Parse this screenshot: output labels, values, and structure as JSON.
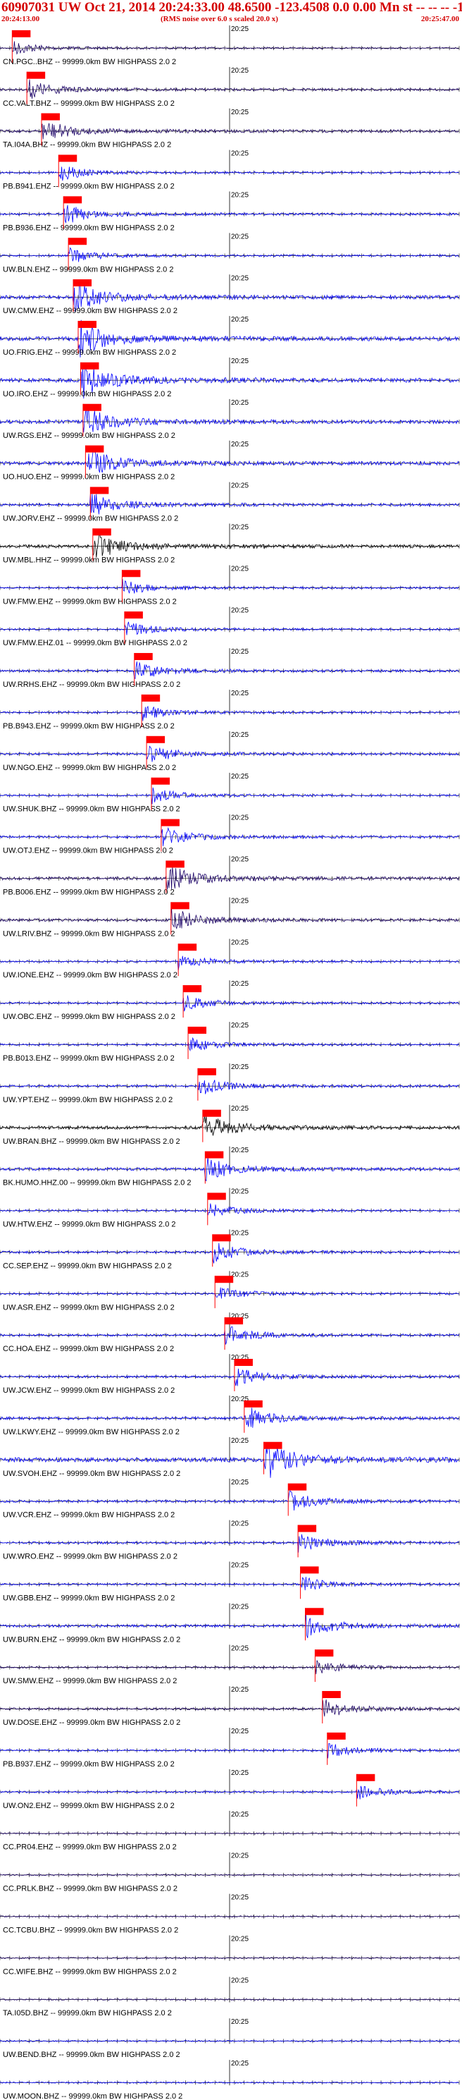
{
  "header": {
    "title": "60907031 UW Oct 21, 2014 20:24:33.00   48.6500 -123.4508  0.0 0.00 Mn st -- -- --  -1",
    "start_time": "20:24:13.00",
    "note": "(RMS noise over 6.0 s scaled 20.0 x)",
    "end_time": "20:25:47.00"
  },
  "chart_data": {
    "type": "seismogram",
    "title": "60907031 UW Oct 21, 2014 20:24:33.00   48.6500 -123.4508  0.0 0.00 Mn st -- -- --  -1",
    "x_start": "20:24:13.00",
    "x_end": "20:25:47.00",
    "x_range_seconds": [
      0,
      94
    ],
    "minute_marker": "20:25",
    "minute_marker_second": 47,
    "tick_interval_seconds": 2,
    "grid": false,
    "colors": {
      "trace": "#0000ff",
      "trace_dark": "#1a0066",
      "pick": "#ff0000",
      "text": "#000000"
    },
    "traces": [
      {
        "label": "CN.PGC..BHZ -- 99999.0km BW  HIGHPASS  2.0  2",
        "pick": 2.5,
        "color": "#1a0066",
        "amp": 0.35
      },
      {
        "label": "CC.VALT.BHZ -- 99999.0km BW  HIGHPASS  2.0  2",
        "pick": 5.5,
        "color": "#1a0066",
        "amp": 0.5
      },
      {
        "label": "TA.I04A.BHZ -- 99999.0km BW  HIGHPASS  2.0  2",
        "pick": 8.5,
        "color": "#1a0066",
        "amp": 0.6
      },
      {
        "label": "PB.B941.EHZ -- 99999.0km BW  HIGHPASS  2.0  2",
        "pick": 12.0,
        "color": "#0000ff",
        "amp": 0.4
      },
      {
        "label": "PB.B936.EHZ -- 99999.0km BW  HIGHPASS  2.0  2",
        "pick": 13.0,
        "color": "#0000ff",
        "amp": 0.5
      },
      {
        "label": "UW.BLN.EHZ -- 99999.0km BW  HIGHPASS  2.0  2",
        "pick": 14.0,
        "color": "#0000ff",
        "amp": 0.4
      },
      {
        "label": "UW.CMW.EHZ -- 99999.0km BW  HIGHPASS  2.0  2",
        "pick": 15.0,
        "color": "#0000ff",
        "amp": 0.8
      },
      {
        "label": "UO.FRIG.EHZ -- 99999.0km BW  HIGHPASS  2.0  2",
        "pick": 16.0,
        "color": "#0000ff",
        "amp": 0.9
      },
      {
        "label": "UO.IRO.EHZ -- 99999.0km BW  HIGHPASS  2.0  2",
        "pick": 16.5,
        "color": "#0000ff",
        "amp": 0.9
      },
      {
        "label": "UW.RGS.EHZ -- 99999.0km BW  HIGHPASS  2.0  2",
        "pick": 17.0,
        "color": "#0000ff",
        "amp": 0.8
      },
      {
        "label": "UO.HUO.EHZ -- 99999.0km BW  HIGHPASS  2.0  2",
        "pick": 17.5,
        "color": "#0000ff",
        "amp": 0.8
      },
      {
        "label": "UW.JORV.EHZ -- 99999.0km BW  HIGHPASS  2.0  2",
        "pick": 18.5,
        "color": "#0000ff",
        "amp": 0.6
      },
      {
        "label": "UW.MBL.HHZ -- 99999.0km BW  HIGHPASS  2.0  2",
        "pick": 19.0,
        "color": "#000000",
        "amp": 0.7
      },
      {
        "label": "UW.FMW.EHZ -- 99999.0km BW  HIGHPASS  2.0  2",
        "pick": 25.0,
        "color": "#0000ff",
        "amp": 0.4
      },
      {
        "label": "UW.FMW.EHZ.01 -- 99999.0km BW  HIGHPASS  2.0  2",
        "pick": 25.5,
        "color": "#0000ff",
        "amp": 0.4
      },
      {
        "label": "UW.RRHS.EHZ -- 99999.0km BW  HIGHPASS  2.0  2",
        "pick": 27.5,
        "color": "#0000ff",
        "amp": 0.5
      },
      {
        "label": "PB.B943.EHZ -- 99999.0km BW  HIGHPASS  2.0  2",
        "pick": 29.0,
        "color": "#0000ff",
        "amp": 0.4
      },
      {
        "label": "UW.NGO.EHZ -- 99999.0km BW  HIGHPASS  2.0  2",
        "pick": 30.0,
        "color": "#0000ff",
        "amp": 0.5
      },
      {
        "label": "UW.SHUK.BHZ -- 99999.0km BW  HIGHPASS  2.0  2",
        "pick": 31.0,
        "color": "#0000ff",
        "amp": 0.4
      },
      {
        "label": "UW.OTJ.EHZ -- 99999.0km BW  HIGHPASS  2.0  2",
        "pick": 33.0,
        "color": "#0000ff",
        "amp": 0.5
      },
      {
        "label": "PB.B006.EHZ -- 99999.0km BW  HIGHPASS  2.0  2",
        "pick": 34.0,
        "color": "#1a0066",
        "amp": 0.7
      },
      {
        "label": "UW.LRIV.BHZ -- 99999.0km BW  HIGHPASS  2.0  2",
        "pick": 35.0,
        "color": "#1a0066",
        "amp": 0.6
      },
      {
        "label": "UW.IONE.EHZ -- 99999.0km BW  HIGHPASS  2.0  2",
        "pick": 36.5,
        "color": "#0000ff",
        "amp": 0.4
      },
      {
        "label": "UW.OBC.EHZ -- 99999.0km BW  HIGHPASS  2.0  2",
        "pick": 37.5,
        "color": "#0000ff",
        "amp": 0.4
      },
      {
        "label": "PB.B013.EHZ -- 99999.0km BW  HIGHPASS  2.0  2",
        "pick": 38.5,
        "color": "#0000ff",
        "amp": 0.4
      },
      {
        "label": "UW.YPT.EHZ -- 99999.0km BW  HIGHPASS  2.0  2",
        "pick": 40.5,
        "color": "#0000ff",
        "amp": 0.5
      },
      {
        "label": "UW.BRAN.BHZ -- 99999.0km BW  HIGHPASS  2.0  2",
        "pick": 41.5,
        "color": "#000000",
        "amp": 0.7
      },
      {
        "label": "BK.HUMO.HHZ.00 -- 99999.0km BW  HIGHPASS  2.0  2",
        "pick": 42.0,
        "color": "#0000ff",
        "amp": 0.6
      },
      {
        "label": "UW.HTW.EHZ -- 99999.0km BW  HIGHPASS  2.0  2",
        "pick": 42.5,
        "color": "#0000ff",
        "amp": 0.4
      },
      {
        "label": "CC.SEP.EHZ -- 99999.0km BW  HIGHPASS  2.0  2",
        "pick": 43.5,
        "color": "#0000ff",
        "amp": 0.5
      },
      {
        "label": "UW.ASR.EHZ -- 99999.0km BW  HIGHPASS  2.0  2",
        "pick": 44.0,
        "color": "#0000ff",
        "amp": 0.4
      },
      {
        "label": "CC.HOA.EHZ -- 99999.0km BW  HIGHPASS  2.0  2",
        "pick": 46.0,
        "color": "#0000ff",
        "amp": 0.5
      },
      {
        "label": "UW.JCW.EHZ -- 99999.0km BW  HIGHPASS  2.0  2",
        "pick": 48.0,
        "color": "#0000ff",
        "amp": 0.5
      },
      {
        "label": "UW.LKWY.EHZ -- 99999.0km BW  HIGHPASS  2.0  2",
        "pick": 50.0,
        "color": "#0000ff",
        "amp": 0.6
      },
      {
        "label": "UW.SVOH.EHZ -- 99999.0km BW  HIGHPASS  2.0  2",
        "pick": 54.0,
        "color": "#0000ff",
        "amp": 1.0
      },
      {
        "label": "UW.VCR.EHZ -- 99999.0km BW  HIGHPASS  2.0  2",
        "pick": 59.0,
        "color": "#0000ff",
        "amp": 0.5
      },
      {
        "label": "UW.WRO.EHZ -- 99999.0km BW  HIGHPASS  2.0  2",
        "pick": 61.0,
        "color": "#0000ff",
        "amp": 0.5
      },
      {
        "label": "UW.GBB.EHZ -- 99999.0km BW  HIGHPASS  2.0  2",
        "pick": 61.5,
        "color": "#0000ff",
        "amp": 0.4
      },
      {
        "label": "UW.BURN.EHZ -- 99999.0km BW  HIGHPASS  2.0  2",
        "pick": 62.5,
        "color": "#0000ff",
        "amp": 0.6
      },
      {
        "label": "UW.SMW.EHZ -- 99999.0km BW  HIGHPASS  2.0  2",
        "pick": 64.5,
        "color": "#1a0066",
        "amp": 0.4
      },
      {
        "label": "UW.DOSE.EHZ -- 99999.0km BW  HIGHPASS  2.0  2",
        "pick": 66.0,
        "color": "#1a0066",
        "amp": 0.5
      },
      {
        "label": "PB.B937.EHZ -- 99999.0km BW  HIGHPASS  2.0  2",
        "pick": 67.0,
        "color": "#0000ff",
        "amp": 0.4
      },
      {
        "label": "UW.ON2.EHZ -- 99999.0km BW  HIGHPASS  2.0  2",
        "pick": 73.0,
        "color": "#0000ff",
        "amp": 0.4
      },
      {
        "label": "CC.PR04.EHZ -- 99999.0km BW  HIGHPASS  2.0  2",
        "pick": null,
        "color": "#1a0066",
        "amp": 0.3
      },
      {
        "label": "CC.PRLK.BHZ -- 99999.0km BW  HIGHPASS  2.0  2",
        "pick": null,
        "color": "#1a0066",
        "amp": 0.3
      },
      {
        "label": "CC.TCBU.BHZ -- 99999.0km BW  HIGHPASS  2.0  2",
        "pick": null,
        "color": "#1a0066",
        "amp": 0.3
      },
      {
        "label": "CC.WIFE.BHZ -- 99999.0km BW  HIGHPASS  2.0  2",
        "pick": null,
        "color": "#1a0066",
        "amp": 0.3
      },
      {
        "label": "TA.I05D.BHZ -- 99999.0km BW  HIGHPASS  2.0  2",
        "pick": null,
        "color": "#1a0066",
        "amp": 0.3
      },
      {
        "label": "UW.BEND.BHZ -- 99999.0km BW  HIGHPASS  2.0  2",
        "pick": null,
        "color": "#0000ff",
        "amp": 0.3
      },
      {
        "label": "UW.MOON.BHZ -- 99999.0km BW  HIGHPASS  2.0  2",
        "pick": null,
        "color": "#0000ff",
        "amp": 0.3
      }
    ]
  }
}
